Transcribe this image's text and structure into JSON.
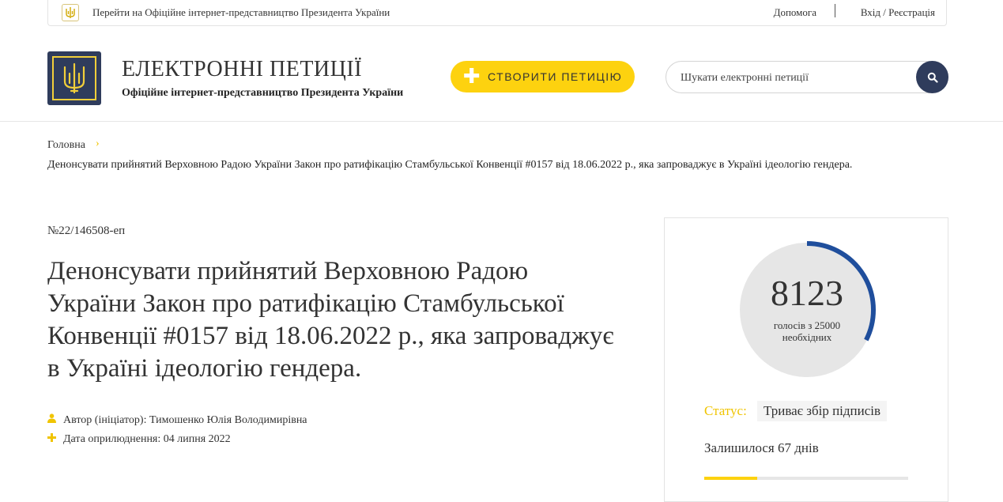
{
  "topbar": {
    "official_link": "Перейти на Офіційне інтернет-представництво Президента України",
    "help": "Допомога",
    "login": "Вхід / Реєстрація"
  },
  "header": {
    "title": "ЕЛЕКТРОННІ ПЕТИЦІЇ",
    "subtitle": "Офіційне інтернет-представництво Президента України",
    "create_button": "СТВОРИТИ ПЕТИЦІЮ",
    "search_placeholder": "Шукати електронні петиції",
    "brand_color": "#2f3c5c",
    "accent_color": "#fdd20f"
  },
  "breadcrumb": {
    "home": "Головна",
    "current": "Денонсувати прийнятий Верховною Радою України Закон про ратифікацію Стамбульської Конвенції #0157 від 18.06.2022 р., яка запроваджує в Україні ідеологію гендера."
  },
  "petition": {
    "number": "№22/146508-еп",
    "title": "Денонсувати прийнятий Верховною Радою України Закон про ратифікацію Стамбульської Конвенції #0157 від 18.06.2022 р., яка запроваджує в Україні ідеологію гендера.",
    "author": "Автор (ініціатор): Тимошенко Юлія Володимирівна",
    "date": "Дата оприлюднення: 04 липня 2022",
    "author_icon": "user-icon",
    "date_icon": "plus-icon"
  },
  "sidebar": {
    "votes": "8123",
    "votes_caption_line1": "голосів з 25000",
    "votes_caption_line2": "необхідних",
    "votes_current": 8123,
    "votes_needed": 25000,
    "status_label": "Статус:",
    "status_value": "Триває збір підписів",
    "days_left": "Залишилося 67 днів",
    "time_progress": 0.26
  }
}
